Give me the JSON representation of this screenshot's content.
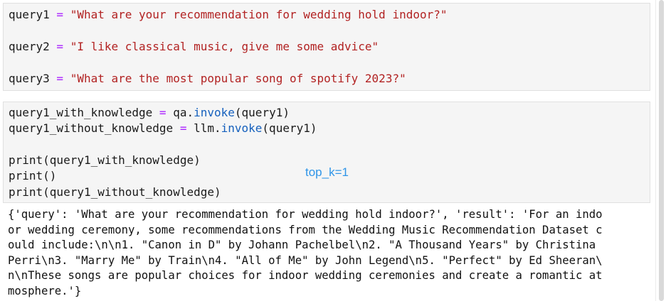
{
  "cell1": {
    "lines": [
      {
        "var": "query1",
        "op": " = ",
        "str": "\"What are your recommendation for wedding hold indoor?\""
      },
      {
        "var": "query2",
        "op": " = ",
        "str": "\"I like classical music, give me some advice\""
      },
      {
        "var": "query3",
        "op": " = ",
        "str": "\"What are the most popular song of spotify 2023?\""
      }
    ]
  },
  "cell2": {
    "line1": {
      "var": "query1_with_knowledge",
      "op": " = ",
      "obj": "qa.",
      "fn": "invoke",
      "args": "(query1)"
    },
    "line2": {
      "var": "query1_without_knowledge",
      "op": " = ",
      "obj": "llm.",
      "fn": "invoke",
      "args": "(query1)"
    },
    "line3": "print(query1_with_knowledge)",
    "line4": "print()",
    "line5": "print(query1_without_knowledge)"
  },
  "annotation": "top_k=1",
  "output": {
    "lines": [
      "{'query': 'What are your recommendation for wedding hold indoor?', 'result': 'For an indo",
      "or wedding ceremony, some recommendations from the Wedding Music Recommendation Dataset c",
      "ould include:\\n\\n1. \"Canon in D\" by Johann Pachelbel\\n2. \"A Thousand Years\" by Christina",
      "Perri\\n3. \"Marry Me\" by Train\\n4. \"All of Me\" by John Legend\\n5. \"Perfect\" by Ed Sheeran\\",
      "n\\nThese songs are popular choices for indoor wedding ceremonies and create a romantic at",
      "mosphere.'}"
    ]
  },
  "colors": {
    "string": "#b22222",
    "operator": "#aa22ff",
    "function": "#1560bd",
    "annotation": "#2f95e8",
    "cell_bg": "#f5f5f5"
  }
}
